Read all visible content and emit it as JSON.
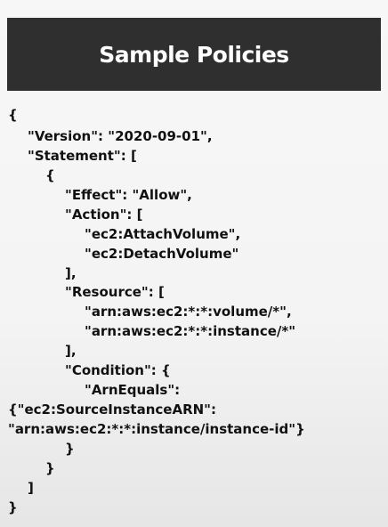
{
  "header": {
    "title": "Sample Policies"
  },
  "code": {
    "lines": [
      "{",
      "\"Version\": \"2020-09-01\",",
      "\"Statement\": [",
      "{",
      "\"Effect\": \"Allow\",",
      "\"Action\": [",
      "\"ec2:AttachVolume\",",
      "\"ec2:DetachVolume\"",
      "],",
      "\"Resource\": [",
      "\"arn:aws:ec2:*:*:volume/*\",",
      "\"arn:aws:ec2:*:*:instance/*\"",
      "],",
      "\"Condition\": {",
      "\"ArnEquals\":",
      "{\"ec2:SourceInstanceARN\":",
      "\"arn:aws:ec2:*:*:instance/instance-id\"}",
      "}",
      "}",
      "]",
      "}"
    ]
  }
}
